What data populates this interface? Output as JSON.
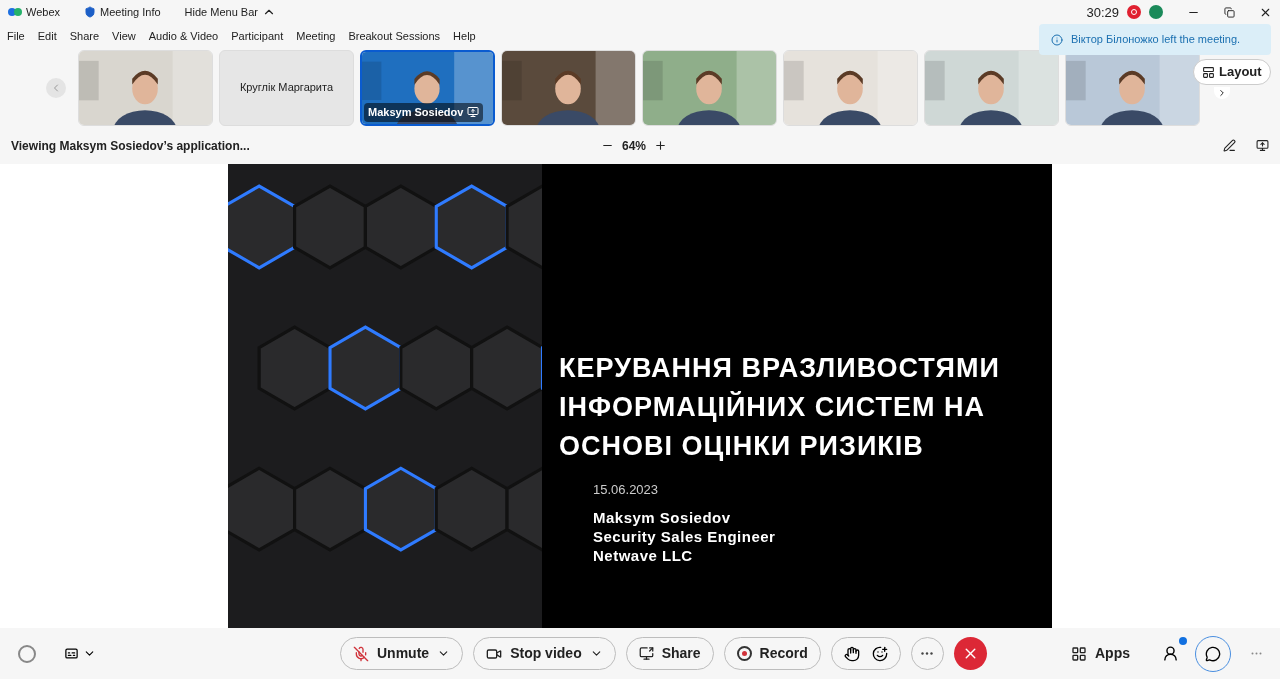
{
  "title_bar": {
    "app_name": "Webex",
    "meeting_info": "Meeting Info",
    "hide_menu_bar": "Hide Menu Bar",
    "timer": "30:29",
    "recording": true
  },
  "menu": [
    "File",
    "Edit",
    "Share",
    "View",
    "Audio & Video",
    "Participant",
    "Meeting",
    "Breakout Sessions",
    "Help"
  ],
  "notification": "Віктор Білоножко left the meeting.",
  "thumbnails": [
    {
      "kind": "video",
      "selected": false,
      "color": "#d9d6cf"
    },
    {
      "kind": "name",
      "name": "Круглік Маргарита",
      "selected": false
    },
    {
      "kind": "video",
      "name": "Maksym Sosiedov",
      "sharing": true,
      "selected": true,
      "color": "#1f6fbf"
    },
    {
      "kind": "video",
      "selected": false,
      "color": "#5a4a3c"
    },
    {
      "kind": "video",
      "selected": false,
      "color": "#8fae8a"
    },
    {
      "kind": "video",
      "selected": false,
      "color": "#e6e2dc"
    },
    {
      "kind": "video",
      "selected": false,
      "color": "#cfd8d6"
    },
    {
      "kind": "video",
      "selected": false,
      "color": "#b9c8d8"
    }
  ],
  "layout_button": "Layout",
  "share_bar": {
    "viewing": "Viewing Maksym Sosiedov’s application...",
    "zoom": "64%"
  },
  "slide": {
    "title_lines": [
      "КЕРУВАННЯ ВРАЗЛИВОСТЯМИ",
      "ІНФОРМАЦІЙНИХ СИСТЕМ НА",
      "ОСНОВІ ОЦІНКИ РИЗИКІВ"
    ],
    "date": "15.06.2023",
    "presenter_lines": [
      "Maksym Sosiedov",
      "Security Sales Engineer",
      "Netwave LLC"
    ]
  },
  "controls": {
    "mute": {
      "label": "Unmute",
      "muted": true
    },
    "video": {
      "label": "Stop video"
    },
    "share": {
      "label": "Share"
    },
    "record": {
      "label": "Record"
    },
    "apps": {
      "label": "Apps"
    },
    "participants_badge": true
  }
}
